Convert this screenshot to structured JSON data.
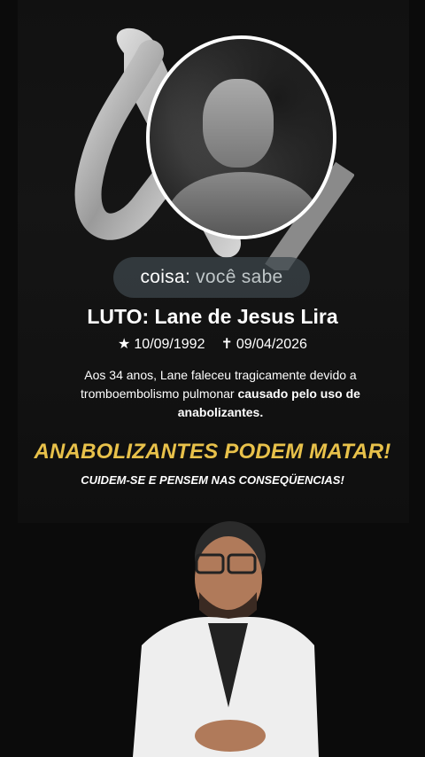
{
  "overlay_caption": {
    "part1": "coisa:",
    "part2": "você sabe"
  },
  "memorial": {
    "title": "LUTO: Lane de Jesus Lira",
    "birth_icon": "star-icon",
    "birth_date": "10/09/1992",
    "death_icon": "cross-icon",
    "death_date": "09/04/2026",
    "paragraph_normal": "Aos 34 anos, Lane faleceu tragicamente devido a tromboembolismo pulmonar ",
    "paragraph_bold": "causado pelo uso de anabolizantes."
  },
  "warning": {
    "headline": "ANABOLIZANTES PODEM MATAR!",
    "subline": "CUIDEM-SE E PENSEM NAS CONSEQÜENCIAS!"
  },
  "colors": {
    "accent_gold": "#e8c14a",
    "background": "#0b0b0b"
  }
}
